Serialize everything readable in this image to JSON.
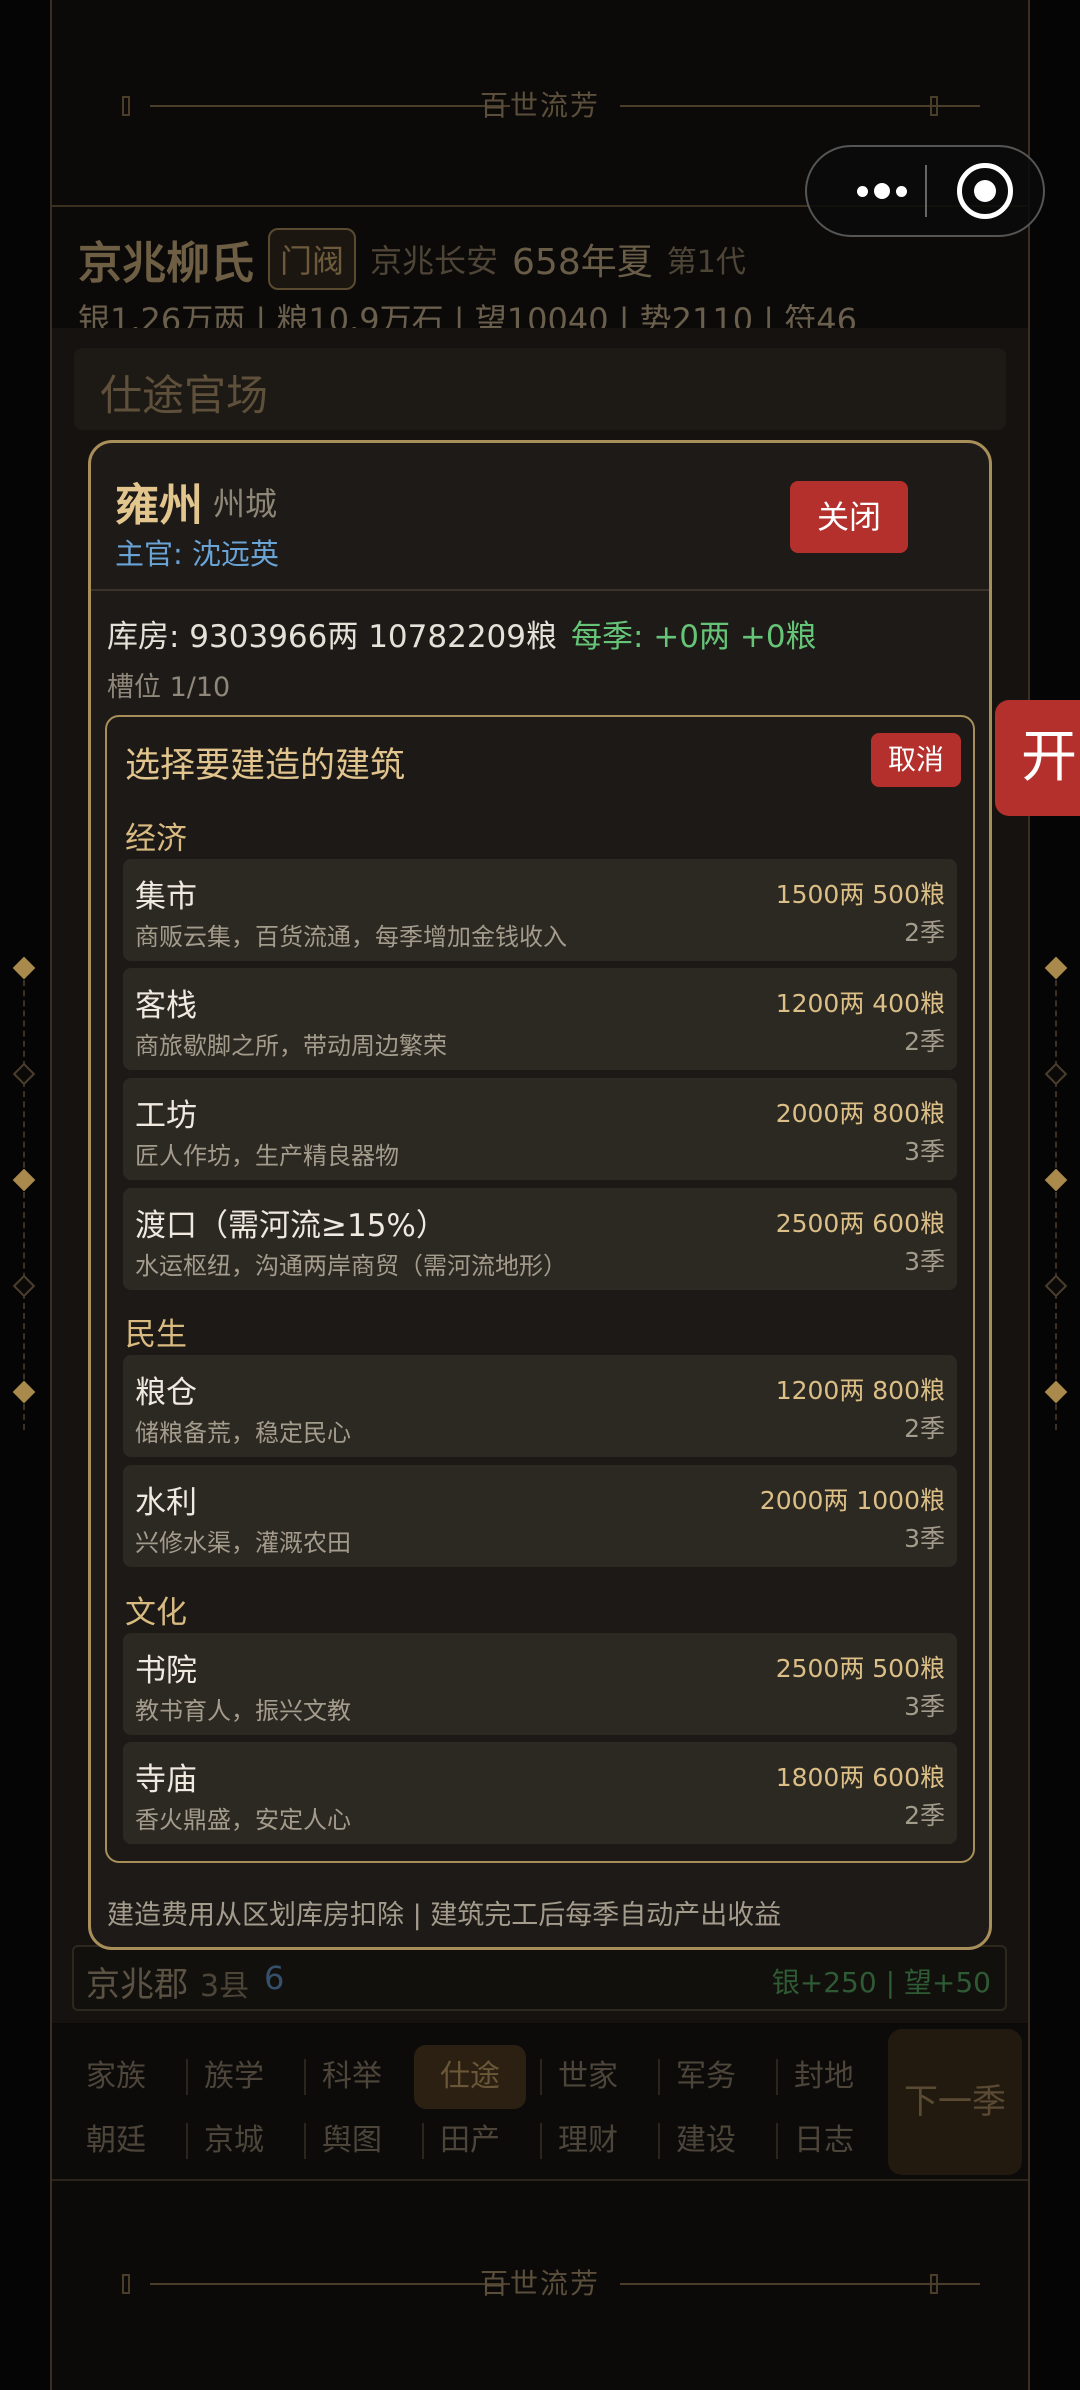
{
  "app": {
    "banner_text": "百世流芳"
  },
  "capsule": {
    "more_icon": "more-icon",
    "close_icon": "target-icon"
  },
  "header": {
    "family": "京兆柳氏",
    "tag": "门阀",
    "location": "京兆长安",
    "year": "658年夏",
    "generation": "第1代",
    "resources": "银1.26万两 | 粮10.9万石 | 望10040 | 势2110 | 符46"
  },
  "background": {
    "section_title": "仕途官场",
    "county": {
      "name": "京兆郡",
      "sub": "3县",
      "num": "6",
      "income": "银+250 | 望+50"
    }
  },
  "side_tab": {
    "label": "开"
  },
  "nav": {
    "row1": [
      "家族",
      "族学",
      "科举",
      "仕途",
      "世家",
      "军务",
      "封地"
    ],
    "row2": [
      "朝廷",
      "京城",
      "舆图",
      "田产",
      "理财",
      "建设",
      "日志"
    ],
    "active": "仕途",
    "next_season": "下一季"
  },
  "modal": {
    "title": "雍州",
    "type": "州城",
    "official": "主官: 沈远英",
    "close_label": "关闭",
    "store": "库房: 9303966两 10782209粮",
    "income": "每季: +0两 +0粮",
    "slots": "槽位 1/10",
    "picker": {
      "title": "选择要建造的建筑",
      "cancel_label": "取消",
      "categories": [
        {
          "name": "经济",
          "items": [
            {
              "name": "集市",
              "desc": "商贩云集，百货流通，每季增加金钱收入",
              "cost": "1500两 500粮",
              "time": "2季"
            },
            {
              "name": "客栈",
              "desc": "商旅歇脚之所，带动周边繁荣",
              "cost": "1200两 400粮",
              "time": "2季"
            },
            {
              "name": "工坊",
              "desc": "匠人作坊，生产精良器物",
              "cost": "2000两 800粮",
              "time": "3季"
            },
            {
              "name": "渡口（需河流≥15%）",
              "desc": "水运枢纽，沟通两岸商贸（需河流地形）",
              "cost": "2500两 600粮",
              "time": "3季"
            }
          ]
        },
        {
          "name": "民生",
          "items": [
            {
              "name": "粮仓",
              "desc": "储粮备荒，稳定民心",
              "cost": "1200两 800粮",
              "time": "2季"
            },
            {
              "name": "水利",
              "desc": "兴修水渠，灌溉农田",
              "cost": "2000两 1000粮",
              "time": "3季"
            }
          ]
        },
        {
          "name": "文化",
          "items": [
            {
              "name": "书院",
              "desc": "教书育人，振兴文教",
              "cost": "2500两 500粮",
              "time": "3季"
            },
            {
              "name": "寺庙",
              "desc": "香火鼎盛，安定人心",
              "cost": "1800两 600粮",
              "time": "2季"
            }
          ]
        }
      ]
    },
    "footer": "建造费用从区划库房扣除 | 建筑完工后每季自动产出收益"
  }
}
